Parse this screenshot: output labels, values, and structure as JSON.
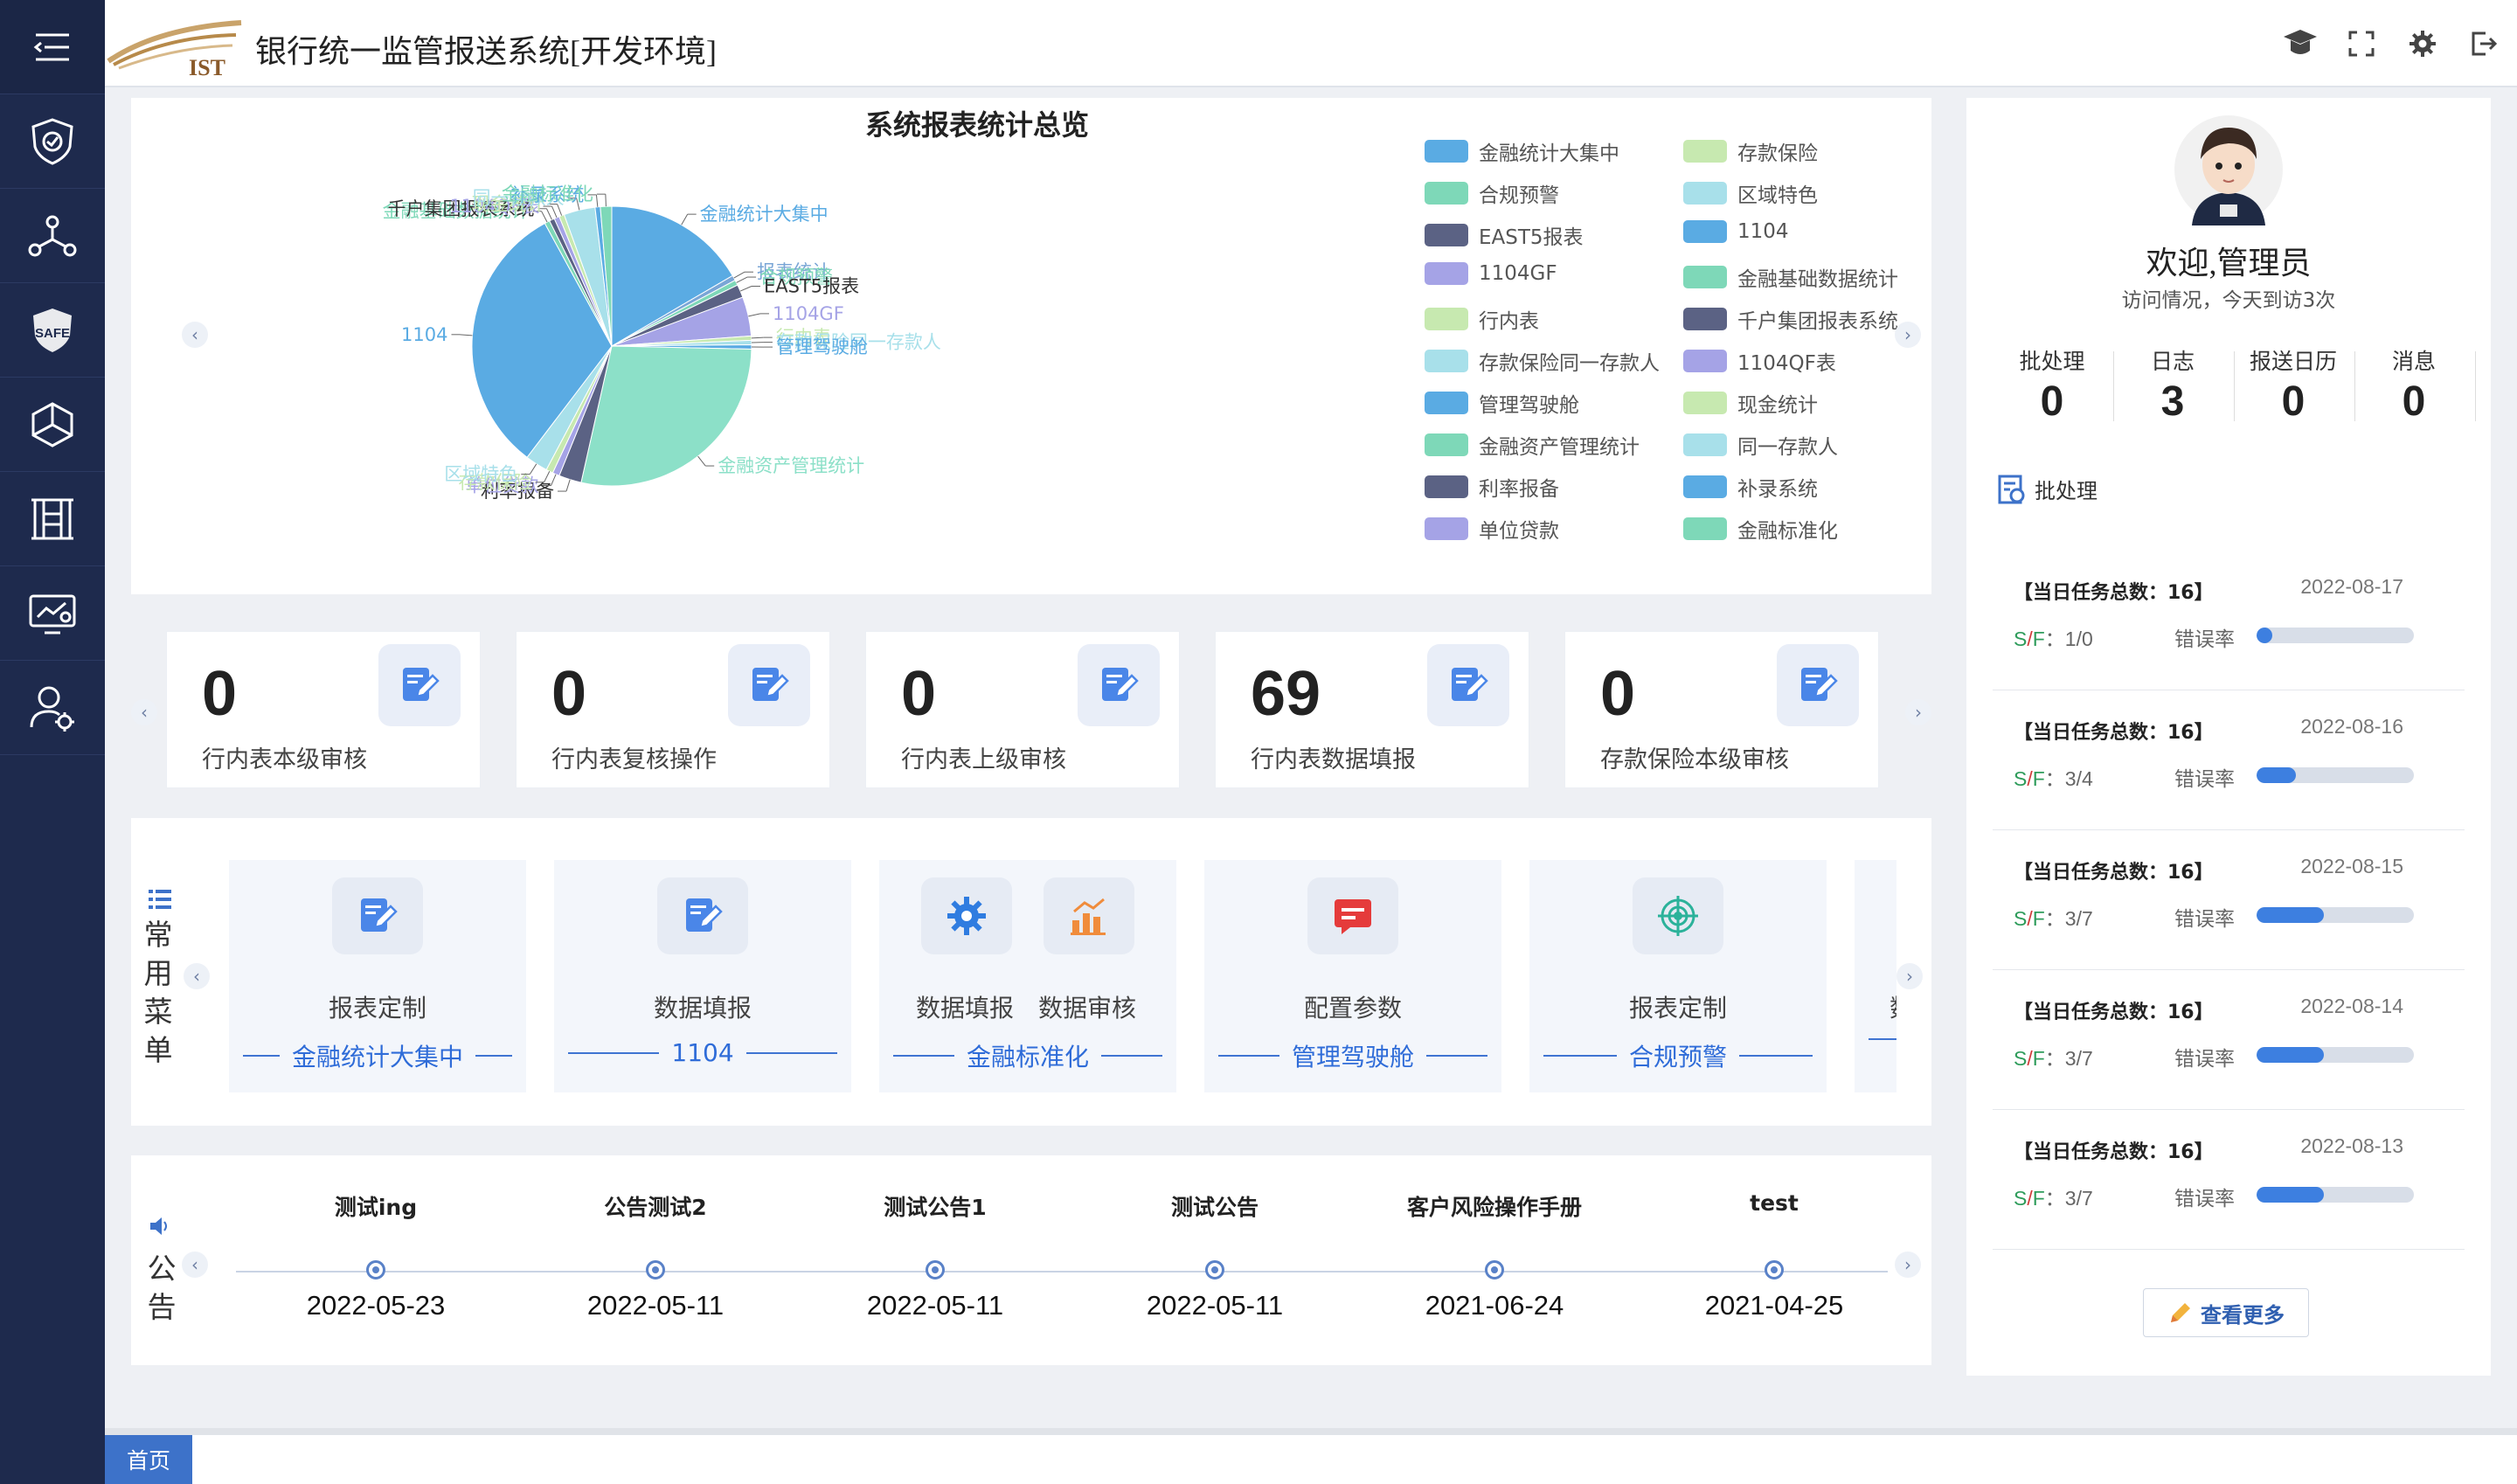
{
  "app": {
    "title": "银行统一监管报送系统[开发环境]",
    "logo_text": "IST"
  },
  "sidebar": {
    "items": [
      {
        "name": "menu-toggle-icon"
      },
      {
        "name": "shield-icon"
      },
      {
        "name": "network-icon"
      },
      {
        "name": "safe-icon"
      },
      {
        "name": "hexagon-nodes-icon"
      },
      {
        "name": "building-icon"
      },
      {
        "name": "monitor-icon"
      },
      {
        "name": "user-settings-icon"
      }
    ]
  },
  "header_icons": [
    "graduation-cap-icon",
    "fullscreen-icon",
    "gear-icon",
    "logout-icon"
  ],
  "chart_data": {
    "type": "pie",
    "title": "系统报表统计总览",
    "slices": [
      {
        "label": "金融统计大集中",
        "value": 16.5,
        "color": "#5aabe3"
      },
      {
        "label": "报表统计",
        "value": 0.6,
        "color": "#7aa6d6"
      },
      {
        "label": "合规预警",
        "value": 0.6,
        "color": "#7ed8b8"
      },
      {
        "label": "EAST5报表",
        "value": 1.5,
        "color": "#5b6284"
      },
      {
        "label": "1104GF",
        "value": 4.5,
        "color": "#a5a3e6"
      },
      {
        "label": "行内表",
        "value": 0.5,
        "color": "#c7e9b0"
      },
      {
        "label": "存款保险同一存款人",
        "value": 0.5,
        "color": "#a8e0ea"
      },
      {
        "label": "管理驾驶舱",
        "value": 0.5,
        "color": "#5aabe3"
      },
      {
        "label": "金融资产管理统计",
        "value": 28.0,
        "color": "#8ce0c8"
      },
      {
        "label": "利率报备",
        "value": 2.6,
        "color": "#5b6284"
      },
      {
        "label": "单位贷款",
        "value": 0.8,
        "color": "#a5a3e6"
      },
      {
        "label": "存款保险",
        "value": 0.8,
        "color": "#c7e9b0"
      },
      {
        "label": "区域特色",
        "value": 2.6,
        "color": "#a8e0ea"
      },
      {
        "label": "1104",
        "value": 31.5,
        "color": "#5aabe3"
      },
      {
        "label": "金融基础数据统计",
        "value": 0.6,
        "color": "#7ed8b8"
      },
      {
        "label": "千户集团报表系统",
        "value": 0.6,
        "color": "#5b6284"
      },
      {
        "label": "1104QF表",
        "value": 0.6,
        "color": "#a5a3e6"
      },
      {
        "label": "现金统计",
        "value": 0.6,
        "color": "#c7e9b0"
      },
      {
        "label": "同一存款人",
        "value": 3.6,
        "color": "#a8e0ea"
      },
      {
        "label": "补录系统",
        "value": 0.6,
        "color": "#5aabe3"
      },
      {
        "label": "金融标准化",
        "value": 1.3,
        "color": "#7ed8b8"
      }
    ],
    "legend": [
      {
        "label": "金融统计大集中",
        "color": "#5aabe3"
      },
      {
        "label": "存款保险",
        "color": "#c7e9b0"
      },
      {
        "label": "合规预警",
        "color": "#7ed8b8"
      },
      {
        "label": "区域特色",
        "color": "#a8e0ea"
      },
      {
        "label": "EAST5报表",
        "color": "#5b6284"
      },
      {
        "label": "1104",
        "color": "#5aabe3"
      },
      {
        "label": "1104GF",
        "color": "#a5a3e6"
      },
      {
        "label": "金融基础数据统计",
        "color": "#7ed8b8"
      },
      {
        "label": "行内表",
        "color": "#c7e9b0"
      },
      {
        "label": "千户集团报表系统",
        "color": "#5b6284"
      },
      {
        "label": "存款保险同一存款人",
        "color": "#a8e0ea"
      },
      {
        "label": "1104QF表",
        "color": "#a5a3e6"
      },
      {
        "label": "管理驾驶舱",
        "color": "#5aabe3"
      },
      {
        "label": "现金统计",
        "color": "#c7e9b0"
      },
      {
        "label": "金融资产管理统计",
        "color": "#7ed8b8"
      },
      {
        "label": "同一存款人",
        "color": "#a8e0ea"
      },
      {
        "label": "利率报备",
        "color": "#5b6284"
      },
      {
        "label": "补录系统",
        "color": "#5aabe3"
      },
      {
        "label": "单位贷款",
        "color": "#a5a3e6"
      },
      {
        "label": "金融标准化",
        "color": "#7ed8b8"
      }
    ]
  },
  "stats": [
    {
      "value": "0",
      "label": "行内表本级审核"
    },
    {
      "value": "0",
      "label": "行内表复核操作"
    },
    {
      "value": "0",
      "label": "行内表上级审核"
    },
    {
      "value": "69",
      "label": "行内表数据填报"
    },
    {
      "value": "0",
      "label": "存款保险本级审核"
    }
  ],
  "common_menu": {
    "title_chars": [
      "常",
      "用",
      "菜",
      "单"
    ],
    "cards": [
      {
        "labels": [
          "报表定制"
        ],
        "sub": "金融统计大集中",
        "icons": [
          "edit-doc-icon"
        ]
      },
      {
        "labels": [
          "数据填报"
        ],
        "sub": "1104",
        "icons": [
          "edit-doc-icon"
        ]
      },
      {
        "labels": [
          "数据填报",
          "数据审核"
        ],
        "sub": "金融标准化",
        "icons": [
          "gear-cog-icon",
          "bar-chart-icon"
        ]
      },
      {
        "labels": [
          "配置参数"
        ],
        "sub": "管理驾驶舱",
        "icons": [
          "message-icon"
        ]
      },
      {
        "labels": [
          "报表定制"
        ],
        "sub": "合规预警",
        "icons": [
          "target-icon"
        ]
      },
      {
        "labels": [
          "数"
        ],
        "sub": "",
        "icons": [
          "edit-doc-icon"
        ]
      }
    ]
  },
  "notices": {
    "title_chars": [
      "公",
      "告"
    ],
    "items": [
      {
        "title": "测试ing",
        "date": "2022-05-23"
      },
      {
        "title": "公告测试2",
        "date": "2022-05-11"
      },
      {
        "title": "测试公告1",
        "date": "2022-05-11"
      },
      {
        "title": "测试公告",
        "date": "2022-05-11"
      },
      {
        "title": "客户风险操作手册",
        "date": "2021-06-24"
      },
      {
        "title": "test",
        "date": "2021-04-25"
      }
    ]
  },
  "user": {
    "welcome": "欢迎,管理员",
    "visit": "访问情况，今天到访3次",
    "counters": [
      {
        "label": "批处理",
        "value": "0"
      },
      {
        "label": "日志",
        "value": "3"
      },
      {
        "label": "报送日历",
        "value": "0"
      },
      {
        "label": "消息",
        "value": "0"
      }
    ],
    "batch_title": "批处理",
    "tasks": [
      {
        "title": "【当日任务总数：16】",
        "date": "2022-08-17",
        "sf_label": "S/F",
        "sf_value": "：1/0",
        "err_label": "错误率",
        "rate": 0.1
      },
      {
        "title": "【当日任务总数：16】",
        "date": "2022-08-16",
        "sf_label": "S/F",
        "sf_value": "：3/4",
        "err_label": "错误率",
        "rate": 0.25
      },
      {
        "title": "【当日任务总数：16】",
        "date": "2022-08-15",
        "sf_label": "S/F",
        "sf_value": "：3/7",
        "err_label": "错误率",
        "rate": 0.43
      },
      {
        "title": "【当日任务总数：16】",
        "date": "2022-08-14",
        "sf_label": "S/F",
        "sf_value": "：3/7",
        "err_label": "错误率",
        "rate": 0.43
      },
      {
        "title": "【当日任务总数：16】",
        "date": "2022-08-13",
        "sf_label": "S/F",
        "sf_value": "：3/7",
        "err_label": "错误率",
        "rate": 0.43
      }
    ],
    "more": "查看更多"
  },
  "tabs": {
    "home": "首页"
  }
}
